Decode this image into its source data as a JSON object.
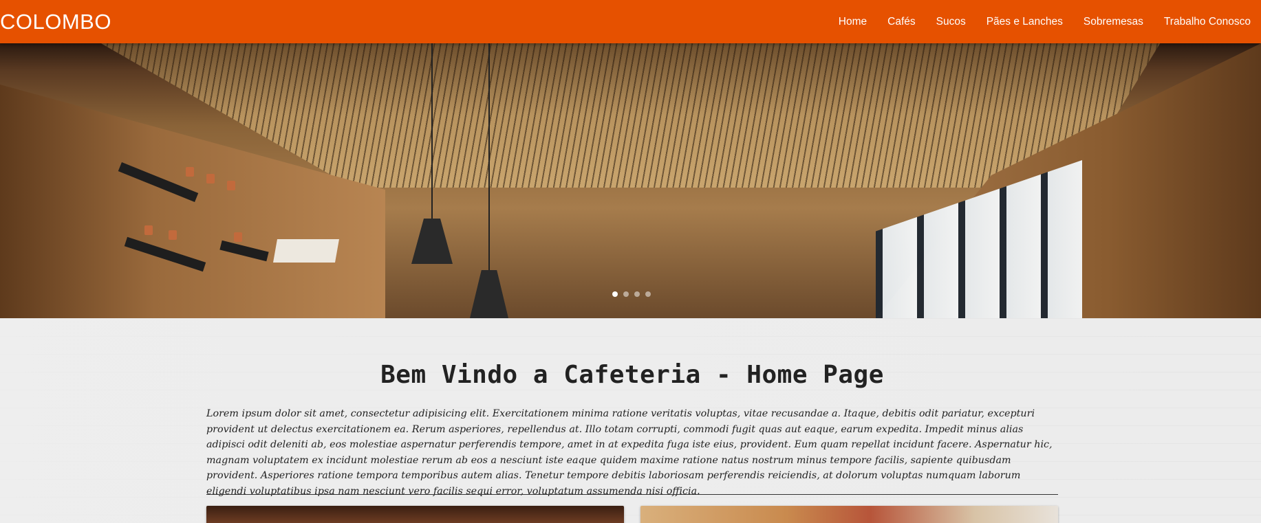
{
  "navbar": {
    "brand": "COLOMBO",
    "links": [
      "Home",
      "Cafés",
      "Sucos",
      "Pães e Lanches",
      "Sobremesas",
      "Trabalho Conosco"
    ],
    "background_color": "#e65100"
  },
  "hero": {
    "slide_count": 4,
    "active_slide": 1
  },
  "main": {
    "title": "Bem Vindo a Cafeteria - Home Page",
    "intro": "Lorem ipsum dolor sit amet, consectetur adipisicing elit. Exercitationem minima ratione veritatis voluptas, vitae recusandae a. Itaque, debitis odit pariatur, excepturi provident ut delectus exercitationem ea. Rerum asperiores, repellendus at. Illo totam corrupti, commodi fugit quas aut eaque, earum expedita. Impedit minus alias adipisci odit deleniti ab, eos molestiae aspernatur perferendis tempore, amet in at expedita fuga iste eius, provident. Eum quam repellat incidunt facere. Aspernatur hic, magnam voluptatem ex incidunt molestiae rerum ab eos a nesciunt iste eaque quidem maxime ratione natus nostrum minus tempore facilis, sapiente quibusdam provident. Asperiores ratione tempora temporibus autem alias. Tenetur tempore debitis laboriosam perferendis reiciendis, at dolorum voluptas numquam laborum eligendi voluptatibus ipsa nam nesciunt vero facilis sequi error, voluptatum assumenda nisi officia."
  }
}
